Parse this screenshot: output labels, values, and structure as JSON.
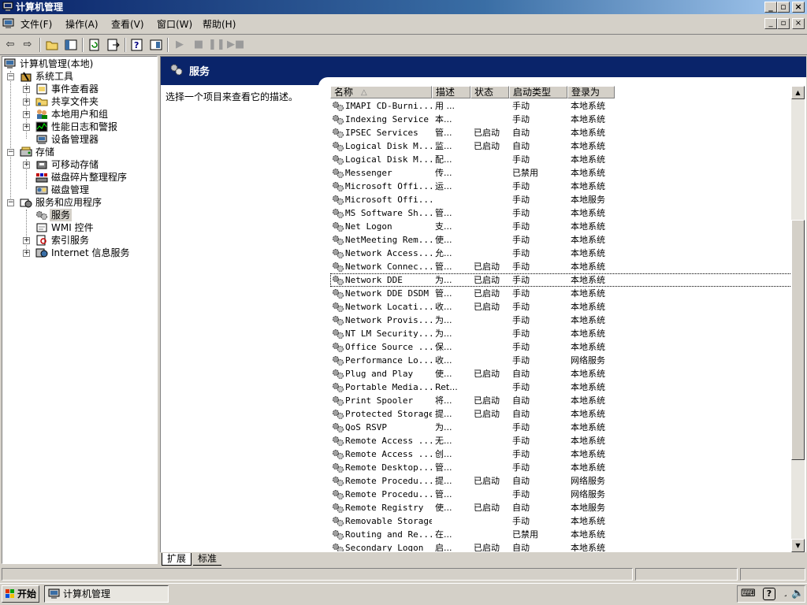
{
  "window": {
    "title": "计算机管理"
  },
  "menu": [
    "文件(F)",
    "操作(A)",
    "查看(V)",
    "窗口(W)",
    "帮助(H)"
  ],
  "tree": {
    "root": "计算机管理(本地)",
    "system_tools": "系统工具",
    "event_viewer": "事件查看器",
    "shared_folders": "共享文件夹",
    "local_users": "本地用户和组",
    "perf_logs": "性能日志和警报",
    "device_manager": "设备管理器",
    "storage": "存储",
    "removable_storage": "可移动存储",
    "defrag": "磁盘碎片整理程序",
    "disk_mgmt": "磁盘管理",
    "services_apps": "服务和应用程序",
    "services": "服务",
    "wmi": "WMI 控件",
    "indexing": "索引服务",
    "iis": "Internet 信息服务"
  },
  "pane": {
    "title": "服务",
    "description": "选择一个项目来查看它的描述。"
  },
  "list": {
    "headers": [
      "名称",
      "描述",
      "状态",
      "启动类型",
      "登录为"
    ],
    "sort_indicator": "△",
    "rows": [
      [
        "IMAPI CD-Burni...",
        "用 ...",
        "",
        "手动",
        "本地系统"
      ],
      [
        "Indexing Service",
        "本...",
        "",
        "手动",
        "本地系统"
      ],
      [
        "IPSEC Services",
        "管...",
        "已启动",
        "自动",
        "本地系统"
      ],
      [
        "Logical Disk M...",
        "监...",
        "已启动",
        "自动",
        "本地系统"
      ],
      [
        "Logical Disk M...",
        "配...",
        "",
        "手动",
        "本地系统"
      ],
      [
        "Messenger",
        "传...",
        "",
        "已禁用",
        "本地系统"
      ],
      [
        "Microsoft Offi...",
        "运...",
        "",
        "手动",
        "本地系统"
      ],
      [
        "Microsoft Offi...",
        "",
        "",
        "手动",
        "本地服务"
      ],
      [
        "MS Software Sh...",
        "管...",
        "",
        "手动",
        "本地系统"
      ],
      [
        "Net Logon",
        "支...",
        "",
        "手动",
        "本地系统"
      ],
      [
        "NetMeeting Rem...",
        "使...",
        "",
        "手动",
        "本地系统"
      ],
      [
        "Network Access...",
        "允...",
        "",
        "手动",
        "本地系统"
      ],
      [
        "Network Connec...",
        "管...",
        "已启动",
        "手动",
        "本地系统"
      ],
      [
        "Network DDE",
        "为...",
        "已启动",
        "手动",
        "本地系统"
      ],
      [
        "Network DDE DSDM",
        "管...",
        "已启动",
        "手动",
        "本地系统"
      ],
      [
        "Network Locati...",
        "收...",
        "已启动",
        "手动",
        "本地系统"
      ],
      [
        "Network Provis...",
        "为...",
        "",
        "手动",
        "本地系统"
      ],
      [
        "NT LM Security...",
        "为...",
        "",
        "手动",
        "本地系统"
      ],
      [
        "Office Source ...",
        "保...",
        "",
        "手动",
        "本地系统"
      ],
      [
        "Performance Lo...",
        "收...",
        "",
        "手动",
        "网络服务"
      ],
      [
        "Plug and Play",
        "使...",
        "已启动",
        "自动",
        "本地系统"
      ],
      [
        "Portable Media...",
        "Ret...",
        "",
        "手动",
        "本地系统"
      ],
      [
        "Print Spooler",
        "将...",
        "已启动",
        "自动",
        "本地系统"
      ],
      [
        "Protected Storage",
        "提...",
        "已启动",
        "自动",
        "本地系统"
      ],
      [
        "QoS RSVP",
        "为...",
        "",
        "手动",
        "本地系统"
      ],
      [
        "Remote Access ...",
        "无...",
        "",
        "手动",
        "本地系统"
      ],
      [
        "Remote Access ...",
        "创...",
        "",
        "手动",
        "本地系统"
      ],
      [
        "Remote Desktop...",
        "管...",
        "",
        "手动",
        "本地系统"
      ],
      [
        "Remote Procedu...",
        "提...",
        "已启动",
        "自动",
        "网络服务"
      ],
      [
        "Remote Procedu...",
        "管...",
        "",
        "手动",
        "网络服务"
      ],
      [
        "Remote Registry",
        "使...",
        "已启动",
        "自动",
        "本地服务"
      ],
      [
        "Removable Storage",
        "",
        "",
        "手动",
        "本地系统"
      ],
      [
        "Routing and Re...",
        "在...",
        "",
        "已禁用",
        "本地系统"
      ],
      [
        "Secondary Logon",
        "启...",
        "已启动",
        "自动",
        "本地系统"
      ]
    ]
  },
  "tabs": [
    "扩展",
    "标准"
  ],
  "taskbar": {
    "start": "开始",
    "task": "计算机管理"
  }
}
